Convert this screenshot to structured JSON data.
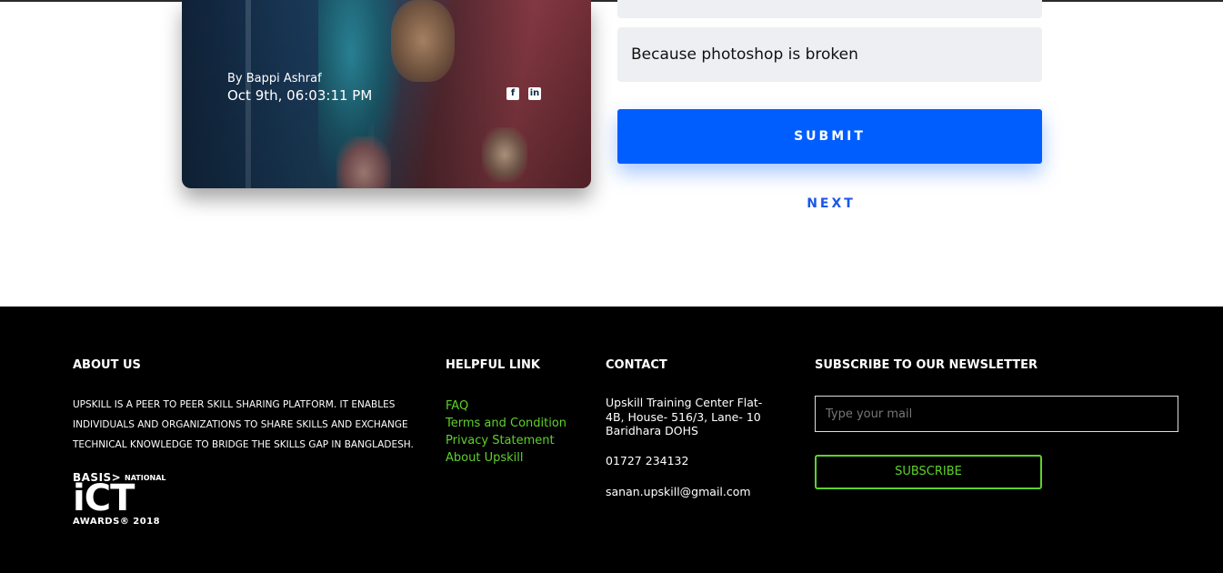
{
  "post": {
    "author": "By Bappi Ashraf",
    "date": "Oct 9th, 06:03:11 PM",
    "social": {
      "facebook_glyph": "f",
      "linkedin_glyph": "in"
    }
  },
  "form": {
    "answer_value": "Because photoshop is broken",
    "submit_label": "SUBMIT",
    "next_label": "NEXT"
  },
  "footer": {
    "about": {
      "heading": "ABOUT US",
      "text": "UPSKILL IS A PEER TO PEER SKILL SHARING PLATFORM. IT ENABLES INDIVIDUALS AND ORGANIZATIONS TO SHARE SKILLS AND EXCHANGE TECHNICAL KNOWLEDGE TO BRIDGE THE SKILLS GAP IN BANGLADESH.",
      "award": {
        "basis": "BASIS>",
        "national": "NATIONAL",
        "ict": "iCT",
        "awards": "AWARDS® 2018"
      }
    },
    "links": {
      "heading": "HELPFUL LINK",
      "items": [
        "FAQ",
        "Terms and Condition",
        "Privacy Statement",
        "About Upskill"
      ]
    },
    "contact": {
      "heading": "CONTACT",
      "address": "Upskill Training Center Flat-4B, House- 516/3, Lane- 10 Baridhara DOHS",
      "phone": "01727 234132",
      "email": "sanan.upskill@gmail.com"
    },
    "newsletter": {
      "heading": "SUBSCRIBE TO OUR NEWSLETTER",
      "placeholder": "Type your mail",
      "button_label": "SUBSCRIBE"
    }
  },
  "colors": {
    "primary_blue": "#005eff",
    "accent_green": "#5fd12a",
    "footer_bg": "#000000"
  }
}
